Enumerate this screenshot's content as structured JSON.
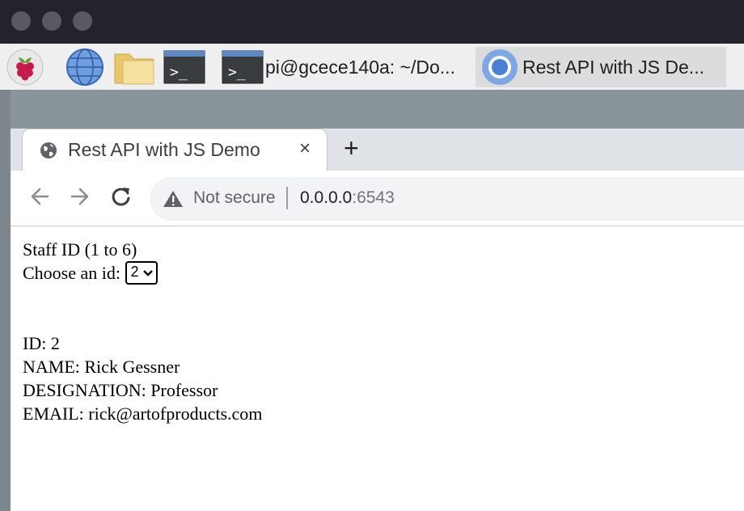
{
  "taskbar": {
    "tasks": [
      {
        "label": "pi@gcece140a: ~/Do..."
      },
      {
        "label": "Rest API with JS De..."
      }
    ]
  },
  "browser": {
    "tab_title": "Rest API with JS Demo",
    "close_glyph": "×",
    "new_tab_glyph": "+",
    "security_label": "Not secure",
    "url_host": "0.0.0.0",
    "url_port": ":6543"
  },
  "page": {
    "heading": "Staff ID (1 to 6)",
    "choose_label": "Choose an id:",
    "selected_id": "2",
    "record": {
      "id": "ID: 2",
      "name": "NAME: Rick Gessner",
      "designation": "DESIGNATION: Professor",
      "email": "EMAIL: rick@artofproducts.com"
    }
  },
  "icons": [
    "raspberry-icon",
    "globe-icon",
    "folder-icon",
    "terminal-icon",
    "chrome-icon",
    "back-icon",
    "forward-icon",
    "reload-icon",
    "warning-icon"
  ],
  "colors": {
    "raspberry": "#c51a4a",
    "chrome_blue": "#4a7fd6",
    "titlebar": "#24222b"
  }
}
